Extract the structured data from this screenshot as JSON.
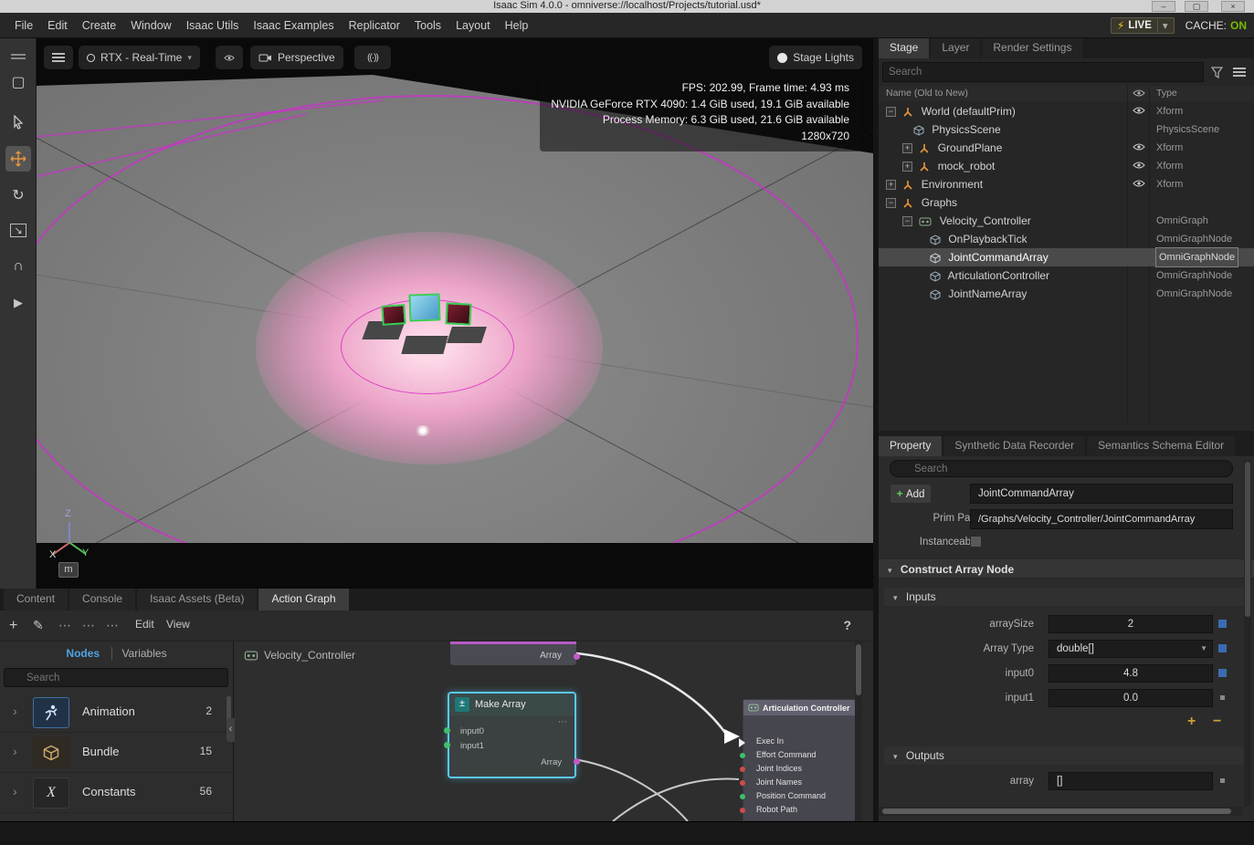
{
  "titlebar": {
    "title": "Isaac Sim 4.0.0 - omniverse://localhost/Projects/tutorial.usd*",
    "minimize": "–",
    "maximize": "▢",
    "close": "×"
  },
  "menubar": {
    "items": [
      "File",
      "Edit",
      "Create",
      "Window",
      "Isaac Utils",
      "Isaac Examples",
      "Replicator",
      "Tools",
      "Layout",
      "Help"
    ],
    "live": {
      "icon": "⚡",
      "label": "LIVE",
      "caret": "▾"
    },
    "cache": {
      "label": "CACHE:",
      "state": "ON"
    }
  },
  "left_toolbar": {
    "select_glyph": "▢",
    "rotate_glyph": "↻",
    "scale_glyph": "↘",
    "snap_glyph": "∩",
    "play_glyph": "▶"
  },
  "viewport": {
    "renderer": "RTX - Real-Time",
    "camera": "Perspective",
    "audio_glyph": "((·))",
    "stage_lights": "Stage Lights",
    "caret": "▾",
    "stats": {
      "line1": "FPS: 202.99, Frame time: 4.93 ms",
      "line2": "NVIDIA GeForce RTX 4090: 1.4 GiB used, 19.1 GiB available",
      "line3": "Process Memory: 6.3 GiB used, 21.6 GiB available",
      "line4": "1280x720"
    },
    "axis": {
      "x": "X",
      "y": "Y",
      "z": "Z"
    },
    "unit": "m"
  },
  "stage": {
    "tabs": [
      "Stage",
      "Layer",
      "Render Settings"
    ],
    "search_placeholder": "Search",
    "columns": {
      "name": "Name (Old to New)",
      "type": "Type"
    },
    "rows": [
      {
        "expander": "−",
        "label": "World (defaultPrim)",
        "type": "Xform"
      },
      {
        "expander": "",
        "label": "PhysicsScene",
        "type": "PhysicsScene"
      },
      {
        "expander": "+",
        "label": "GroundPlane",
        "type": "Xform"
      },
      {
        "expander": "+",
        "label": "mock_robot",
        "type": "Xform"
      },
      {
        "expander": "+",
        "label": "Environment",
        "type": "Xform"
      },
      {
        "expander": "−",
        "label": "Graphs",
        "type": ""
      },
      {
        "expander": "−",
        "label": "Velocity_Controller",
        "type": "OmniGraph"
      },
      {
        "expander": "",
        "label": "OnPlaybackTick",
        "type": "OmniGraphNode"
      },
      {
        "expander": "",
        "label": "JointCommandArray",
        "type": "OmniGraphNode"
      },
      {
        "expander": "",
        "label": "ArticulationController",
        "type": "OmniGraphNode"
      },
      {
        "expander": "",
        "label": "JointNameArray",
        "type": "OmniGraphNode"
      }
    ]
  },
  "property": {
    "tabs": [
      "Property",
      "Synthetic Data Recorder",
      "Semantics Schema Editor"
    ],
    "search_placeholder": "Search",
    "add_plus": "+",
    "add_label": "Add",
    "prim_name": "JointCommandArray",
    "prim_path_label": "Prim Path",
    "prim_path": "/Graphs/Velocity_Controller/JointCommandArray",
    "instanceable_label": "Instanceable",
    "construct_section": "Construct Array Node",
    "inputs_section": "Inputs",
    "outputs_section": "Outputs",
    "caret": "▾",
    "dropdown_caret": "▼",
    "fields": {
      "array_size_label": "arraySize",
      "array_size_value": "2",
      "array_type_label": "Array Type",
      "array_type_value": "double[]",
      "input0_label": "input0",
      "input0_value": "4.8",
      "input1_label": "input1",
      "input1_value": "0.0",
      "array_label": "array",
      "array_value": "[]"
    },
    "add_item_glyph": "+",
    "remove_item_glyph": "−"
  },
  "bottom": {
    "tabs": [
      "Content",
      "Console",
      "Isaac Assets (Beta)",
      "Action Graph"
    ],
    "toolbar": {
      "add": "+",
      "pencil": "✎",
      "dots1": "⋯",
      "dots2": "⋯",
      "dots3": "⋯",
      "edit": "Edit",
      "view": "View",
      "help": "?"
    },
    "catalog": {
      "nodes_tab": "Nodes",
      "variables_tab": "Variables",
      "search_placeholder": "Search",
      "chevron": "›",
      "items": [
        {
          "label": "Animation",
          "count": "2"
        },
        {
          "label": "Bundle",
          "count": "15"
        },
        {
          "label": "Constants",
          "count": "56",
          "glyph": "X"
        }
      ]
    },
    "collapse_glyph": "‹",
    "graph": {
      "title": "Velocity_Controller",
      "float_node_output": "Array",
      "make_array": {
        "title": "Make Array",
        "icon_glyph": "±",
        "menu": "⋯",
        "input0": "input0",
        "input1": "input1",
        "output": "Array"
      },
      "articulation": {
        "title": "Articulation Controller",
        "pins": [
          {
            "label": "Exec In",
            "color": "exec"
          },
          {
            "label": "Effort Command",
            "color": "green"
          },
          {
            "label": "Joint Indices",
            "color": "red"
          },
          {
            "label": "Joint Names",
            "color": "red"
          },
          {
            "label": "Position Command",
            "color": "green"
          },
          {
            "label": "Robot Path",
            "color": "red"
          }
        ]
      }
    }
  },
  "colors": {
    "accent_blue": "#4fa3e3",
    "nvidia_green": "#76b900",
    "live_yellow": "#f2c230",
    "selection_gray": "#4a4a4a",
    "node_selection_cyan": "#5bc8f0",
    "pin_green": "#3fbf6f",
    "pin_red": "#d04a4a",
    "pin_magenta": "#c45ac8",
    "xform_icon_orange": "#e8963c",
    "spotlight_pink": "#f5b5d2",
    "ring_magenta": "#d828d8"
  }
}
